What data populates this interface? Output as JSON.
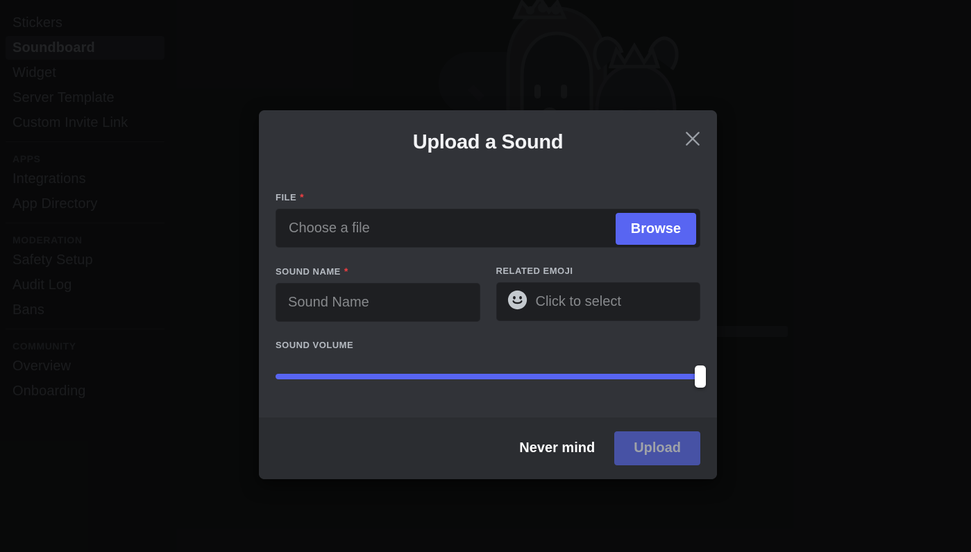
{
  "sidebar": {
    "items": [
      {
        "label": "Stickers",
        "type": "item",
        "active": false
      },
      {
        "label": "Soundboard",
        "type": "item",
        "active": true
      },
      {
        "label": "Widget",
        "type": "item",
        "active": false
      },
      {
        "label": "Server Template",
        "type": "item",
        "active": false
      },
      {
        "label": "Custom Invite Link",
        "type": "item",
        "active": false
      },
      {
        "label": "",
        "type": "divider",
        "active": false
      },
      {
        "label": "APPS",
        "type": "header",
        "active": false
      },
      {
        "label": "Integrations",
        "type": "item",
        "active": false
      },
      {
        "label": "App Directory",
        "type": "item",
        "active": false
      },
      {
        "label": "",
        "type": "divider",
        "active": false
      },
      {
        "label": "MODERATION",
        "type": "header",
        "active": false
      },
      {
        "label": "Safety Setup",
        "type": "item",
        "active": false
      },
      {
        "label": "Audit Log",
        "type": "item",
        "active": false
      },
      {
        "label": "Bans",
        "type": "item",
        "active": false
      },
      {
        "label": "",
        "type": "divider",
        "active": false
      },
      {
        "label": "COMMUNITY",
        "type": "header",
        "active": false
      },
      {
        "label": "Overview",
        "type": "item",
        "active": false
      },
      {
        "label": "Onboarding",
        "type": "item",
        "active": false
      }
    ]
  },
  "modal": {
    "title": "Upload a Sound",
    "close_label": "×",
    "file": {
      "label": "FILE",
      "required_marker": "*",
      "placeholder": "Choose a file",
      "value": "",
      "browse_label": "Browse"
    },
    "sound_name": {
      "label": "SOUND NAME",
      "required_marker": "*",
      "placeholder": "Sound Name",
      "value": ""
    },
    "related_emoji": {
      "label": "RELATED EMOJI",
      "placeholder": "Click to select",
      "value": "",
      "icon": "smiley-face-icon"
    },
    "sound_volume": {
      "label": "SOUND VOLUME",
      "value": 100,
      "min": 0,
      "max": 100
    },
    "footer": {
      "cancel_label": "Never mind",
      "submit_label": "Upload",
      "submit_disabled": true
    }
  },
  "colors": {
    "accent": "#5865F2",
    "accent_disabled": "#4752A5",
    "modal_body": "#313338",
    "modal_footer": "#2B2D31",
    "input_bg": "#1E1F22",
    "required_red": "#F23F42",
    "slider_track": "#4E5058",
    "slider_thumb": "#FFFFFF"
  }
}
